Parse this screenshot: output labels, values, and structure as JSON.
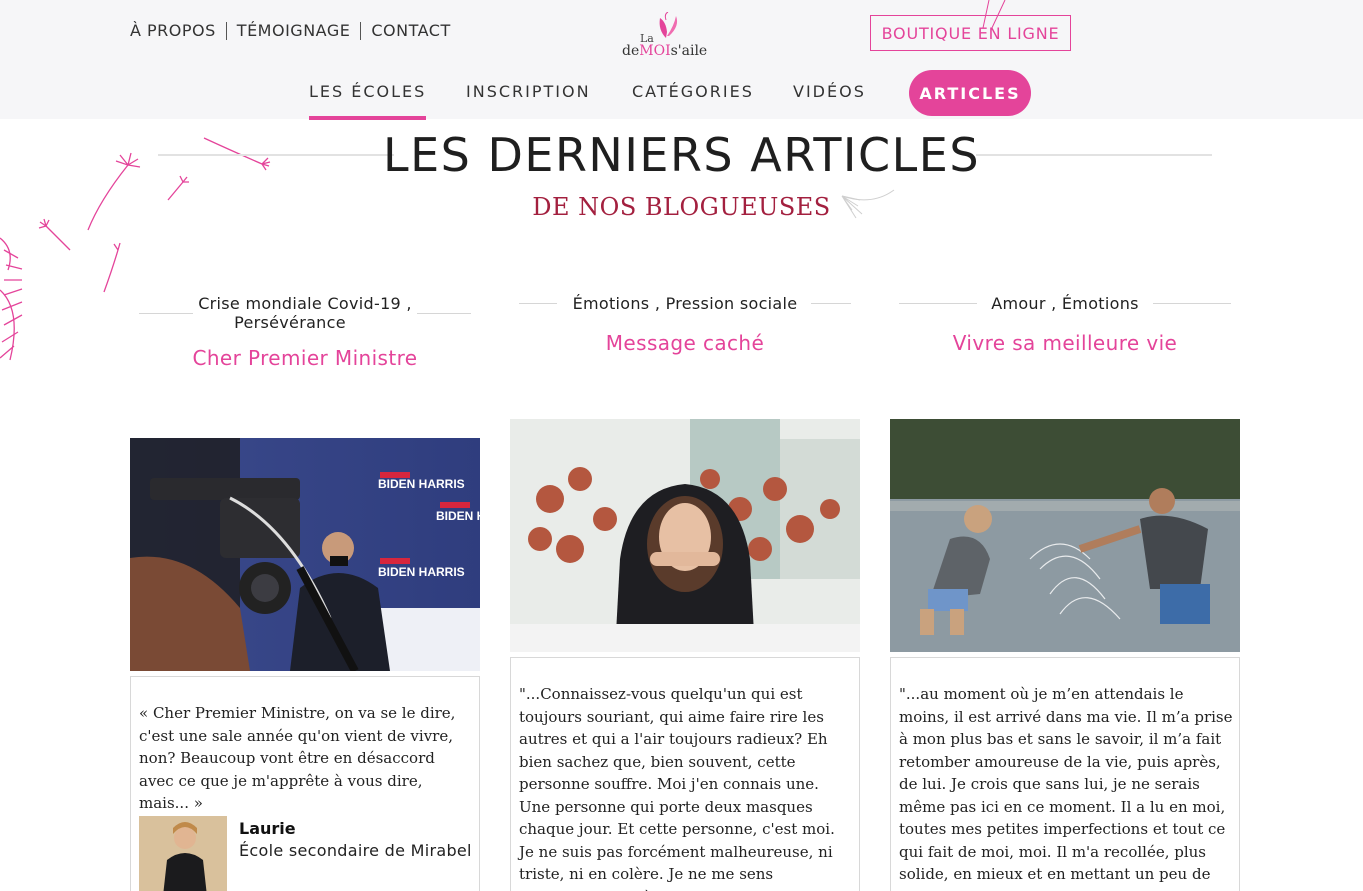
{
  "header": {
    "top_links": [
      "À PROPOS",
      "TÉMOIGNAGE",
      "CONTACT"
    ],
    "logo": {
      "la": "La",
      "de": "de",
      "moi": "MOI",
      "saile": "s'aile"
    },
    "shop_button": "BOUTIQUE EN LIGNE",
    "nav": [
      "LES ÉCOLES",
      "INSCRIPTION",
      "CATÉGORIES",
      "VIDÉOS"
    ],
    "nav_active": "LES ÉCOLES",
    "nav_highlight": "ARTICLES"
  },
  "page": {
    "title": "LES DERNIERS ARTICLES",
    "subtitle": "DE NOS BLOGUEUSES"
  },
  "articles": [
    {
      "categories_line1": "Crise mondiale Covid-19 ,",
      "categories_line2": "Persévérance",
      "title": "Cher Premier Ministre",
      "excerpt": "« Cher Premier Ministre, on va se le dire, c'est une sale année qu'on vient de vivre, non? Beaucoup vont être en désaccord avec ce que je m'apprête à vous dire, mais... »",
      "author_name": "Laurie",
      "author_school": "École secondaire de Mirabel",
      "photo_text": "BIDEN HARRIS"
    },
    {
      "categories_line1": "Émotions , Pression sociale",
      "title": "Message caché",
      "excerpt": "\"...Connaissez-vous quelqu'un qui est toujours souriant, qui aime faire rire les autres et qui a l'air toujours radieux? Eh bien sachez que, bien souvent, cette personne souffre. Moi j'en connais une. Une personne qui porte deux masques chaque jour. Et cette personne, c'est moi. Je ne suis pas forcément malheureuse, ni triste, ni en colère. Je ne me sens simplement pas à ma place...\""
    },
    {
      "categories_line1": "Amour , Émotions",
      "title": "Vivre sa meilleure vie",
      "excerpt": "\"...au moment où je m’en attendais le moins, il est arrivé dans ma vie. Il m’a prise à mon plus bas et sans le savoir, il m’a fait retomber amoureuse de la vie, puis après, de lui. Je crois que sans lui, je ne serais même pas ici en ce moment. Il a lu en moi, toutes mes petites imperfections et tout ce qui fait de moi, moi. Il m'a recollée, plus solide, en mieux et en mettant un peu de lui dans tout ça.\""
    }
  ],
  "colors": {
    "accent": "#e4449a",
    "subtitle": "#a3203f",
    "header_bg": "#f6f6f8"
  }
}
